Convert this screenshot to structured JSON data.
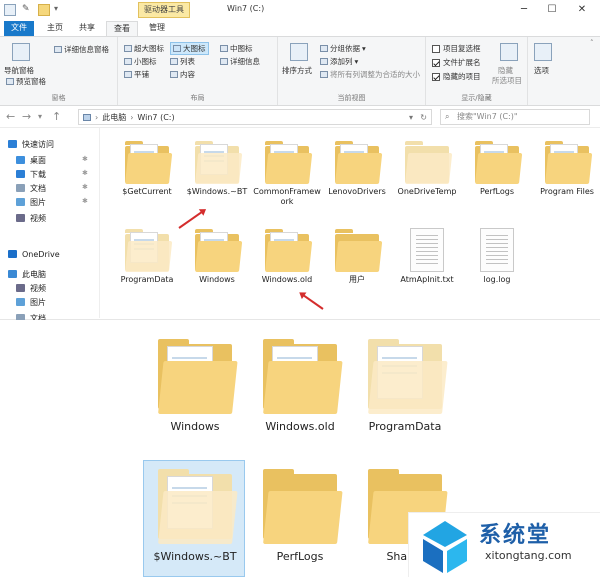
{
  "titlebar": {
    "contextual_tab": "驱动器工具",
    "title": "Win7 (C:)",
    "minimize": "─",
    "maximize": "☐",
    "close": "✕"
  },
  "tabs": {
    "file": "文件",
    "home": "主页",
    "share": "共享",
    "view": "查看",
    "manage": "管理"
  },
  "ribbon": {
    "pane": {
      "nav_pane": "导航窗格",
      "preview_pane": "预览窗格",
      "details_pane": "详细信息窗格",
      "group_label": "窗格"
    },
    "layout": {
      "extra_large": "超大图标",
      "large": "大图标",
      "medium": "中图标",
      "small": "小图标",
      "list": "列表",
      "details": "详细信息",
      "tiles": "平铺",
      "content": "内容",
      "group_label": "布局"
    },
    "current_view": {
      "sort_by": "排序方式",
      "group_by": "分组依据",
      "add_columns": "添加列",
      "size_columns": "将所有列调整为合适的大小",
      "group_label": "当前视图"
    },
    "show_hide": {
      "item_checkboxes": "项目复选框",
      "file_extensions": "文件扩展名",
      "hidden_items": "隐藏的项目",
      "hide_selected": "隐藏",
      "hide_selected_2": "所选项目",
      "group_label": "显示/隐藏"
    },
    "options": "选项"
  },
  "address": {
    "path_root": "此电脑",
    "path_drive": "Win7 (C:)",
    "search_placeholder": "搜索\"Win7 (C:)\""
  },
  "sidebar": {
    "items": [
      {
        "label": "快速访问",
        "icon": "star-icon",
        "color": "#2b7fd6"
      },
      {
        "label": "桌面",
        "icon": "desktop-icon",
        "color": "#3d8fdd"
      },
      {
        "label": "下载",
        "icon": "download-icon",
        "color": "#2b7fd6"
      },
      {
        "label": "文档",
        "icon": "documents-icon",
        "color": "#8aa0b8"
      },
      {
        "label": "图片",
        "icon": "pictures-icon",
        "color": "#5ea1d8"
      },
      {
        "label": "视频",
        "icon": "video-icon",
        "color": "#6b6b8a"
      },
      {
        "label": "OneDrive",
        "icon": "cloud-icon",
        "color": "#1b6fc9"
      },
      {
        "label": "此电脑",
        "icon": "computer-icon",
        "color": "#3a89d4"
      },
      {
        "label": "视频",
        "icon": "video-icon",
        "color": "#6b6b8a"
      },
      {
        "label": "图片",
        "icon": "pictures-icon",
        "color": "#5ea1d8"
      },
      {
        "label": "文档",
        "icon": "documents-icon",
        "color": "#8aa0b8"
      }
    ]
  },
  "files": [
    {
      "name": "$GetCurrent",
      "kind": "folder",
      "hidden": false
    },
    {
      "name": "$Windows.~BT",
      "kind": "folder",
      "hidden": true
    },
    {
      "name": "CommonFramework",
      "kind": "folder",
      "hidden": false
    },
    {
      "name": "LenovoDrivers",
      "kind": "folder",
      "hidden": false
    },
    {
      "name": "OneDriveTemp",
      "kind": "folder",
      "hidden": true
    },
    {
      "name": "PerfLogs",
      "kind": "folder",
      "hidden": false
    },
    {
      "name": "Program Files",
      "kind": "folder",
      "hidden": false
    },
    {
      "name": "ProgramData",
      "kind": "folder",
      "hidden": true
    },
    {
      "name": "Windows",
      "kind": "folder",
      "hidden": false
    },
    {
      "name": "Windows.old",
      "kind": "folder",
      "hidden": false
    },
    {
      "name": "用户",
      "kind": "folder",
      "hidden": false
    },
    {
      "name": "AtmApInit.txt",
      "kind": "file",
      "hidden": false
    },
    {
      "name": "log.log",
      "kind": "file",
      "hidden": false
    }
  ],
  "zoom_view": {
    "row1": [
      "Windows",
      "Windows.old",
      "ProgramData"
    ],
    "row2": [
      "$Windows.~BT",
      "PerfLogs",
      "Shaikh"
    ]
  },
  "watermark": {
    "brand": "系统堂",
    "url": "xitongtang.com"
  },
  "colors": {
    "accent": "#1979ca",
    "annotation_arrow": "#d42d2d",
    "folder": "#f7d47e",
    "selection": "#d5e9f8"
  }
}
